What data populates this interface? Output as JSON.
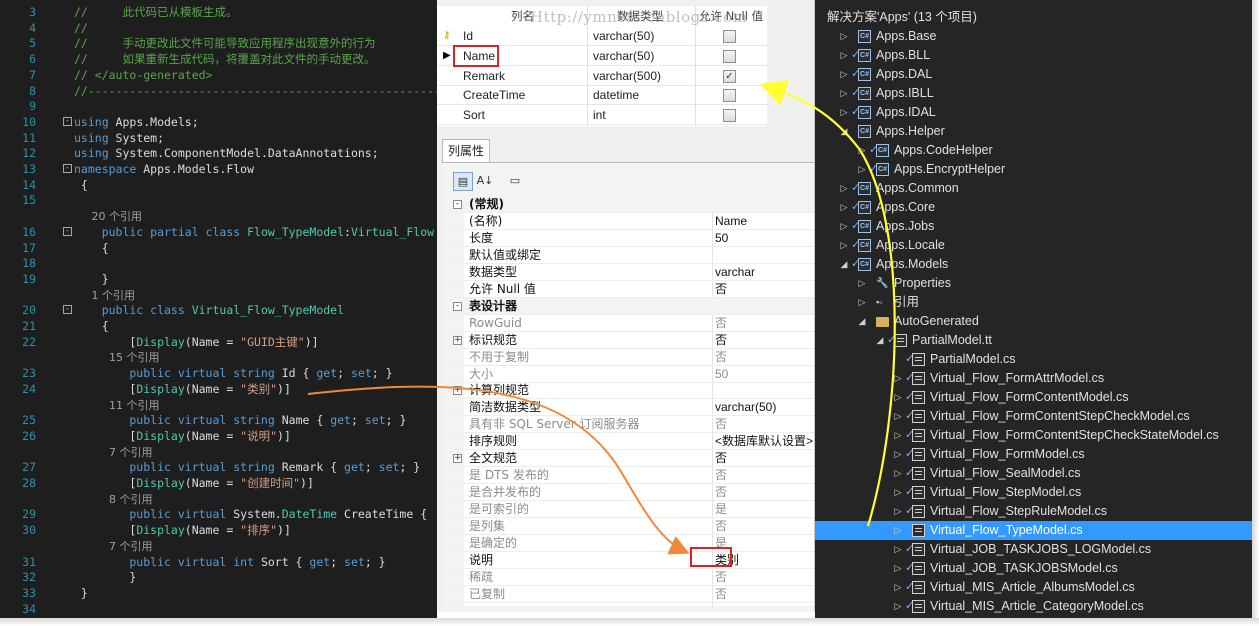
{
  "editor": {
    "lines": [
      {
        "num": "3",
        "fold": "",
        "parts": [
          {
            "t": "//     此代码已从模板生成。",
            "c": "c-com"
          }
        ]
      },
      {
        "num": "4",
        "fold": "",
        "parts": [
          {
            "t": "//",
            "c": "c-com"
          }
        ]
      },
      {
        "num": "5",
        "fold": "",
        "parts": [
          {
            "t": "//     手动更改此文件可能导致应用程序出现意外的行为",
            "c": "c-com"
          }
        ]
      },
      {
        "num": "6",
        "fold": "",
        "parts": [
          {
            "t": "//     如果重新生成代码，将覆盖对此文件的手动更改。",
            "c": "c-com"
          }
        ]
      },
      {
        "num": "7",
        "fold": "",
        "parts": [
          {
            "t": "// </auto-generated>",
            "c": "c-com"
          }
        ]
      },
      {
        "num": "8",
        "fold": "",
        "parts": [
          {
            "t": "//------------------------------------------------------------------",
            "c": "c-com"
          }
        ]
      },
      {
        "num": "9",
        "fold": "",
        "parts": []
      },
      {
        "num": "10",
        "fold": "-",
        "parts": [
          {
            "t": "using",
            "c": "c-kw"
          },
          {
            "t": " Apps.Models;",
            "c": "c-plain"
          }
        ]
      },
      {
        "num": "11",
        "fold": "",
        "parts": [
          {
            "t": "using",
            "c": "c-kw"
          },
          {
            "t": " System;",
            "c": "c-plain"
          }
        ]
      },
      {
        "num": "12",
        "fold": "",
        "parts": [
          {
            "t": "using",
            "c": "c-kw"
          },
          {
            "t": " System.ComponentModel.DataAnnotations;",
            "c": "c-plain"
          }
        ]
      },
      {
        "num": "13",
        "fold": "-",
        "parts": [
          {
            "t": "namespace",
            "c": "c-kw"
          },
          {
            "t": " Apps.Models.Flow",
            "c": "c-plain"
          }
        ]
      },
      {
        "num": "14",
        "fold": "",
        "parts": [
          {
            "t": " {",
            "c": "c-plain"
          }
        ]
      },
      {
        "num": "15",
        "fold": "",
        "parts": []
      },
      {
        "num": "",
        "fold": "",
        "ref": true,
        "parts": [
          {
            "t": "     20 个引用",
            "c": "ref"
          }
        ]
      },
      {
        "num": "16",
        "fold": "-",
        "parts": [
          {
            "t": "    public partial class ",
            "c": "c-kw"
          },
          {
            "t": "Flow_TypeModel",
            "c": "c-type"
          },
          {
            "t": ":",
            "c": "c-plain"
          },
          {
            "t": "Virtual_Flow",
            "c": "c-type"
          }
        ]
      },
      {
        "num": "17",
        "fold": "",
        "parts": [
          {
            "t": "    {",
            "c": "c-plain"
          }
        ]
      },
      {
        "num": "18",
        "fold": "",
        "parts": []
      },
      {
        "num": "19",
        "fold": "",
        "parts": [
          {
            "t": "    }",
            "c": "c-plain"
          }
        ]
      },
      {
        "num": "",
        "fold": "",
        "ref": true,
        "parts": [
          {
            "t": "     1 个引用",
            "c": "ref"
          }
        ]
      },
      {
        "num": "20",
        "fold": "-",
        "parts": [
          {
            "t": "    public class ",
            "c": "c-kw"
          },
          {
            "t": "Virtual_Flow_TypeModel",
            "c": "c-type"
          }
        ]
      },
      {
        "num": "21",
        "fold": "",
        "parts": [
          {
            "t": "    {",
            "c": "c-plain"
          }
        ]
      },
      {
        "num": "22",
        "fold": "",
        "parts": [
          {
            "t": "        [",
            "c": "c-plain"
          },
          {
            "t": "Display",
            "c": "c-type"
          },
          {
            "t": "(Name = ",
            "c": "c-plain"
          },
          {
            "t": "\"GUID主键\"",
            "c": "c-str"
          },
          {
            "t": ")]",
            "c": "c-plain"
          }
        ]
      },
      {
        "num": "",
        "fold": "",
        "ref": true,
        "parts": [
          {
            "t": "          15 个引用",
            "c": "ref"
          }
        ]
      },
      {
        "num": "23",
        "fold": "",
        "parts": [
          {
            "t": "        public virtual string ",
            "c": "c-kw"
          },
          {
            "t": "Id { ",
            "c": "c-plain"
          },
          {
            "t": "get",
            "c": "c-kw"
          },
          {
            "t": "; ",
            "c": "c-plain"
          },
          {
            "t": "set",
            "c": "c-kw"
          },
          {
            "t": "; }",
            "c": "c-plain"
          }
        ]
      },
      {
        "num": "24",
        "fold": "",
        "parts": [
          {
            "t": "        [",
            "c": "c-plain"
          },
          {
            "t": "Display",
            "c": "c-type"
          },
          {
            "t": "(Name = ",
            "c": "c-plain"
          },
          {
            "t": "\"类别\"",
            "c": "c-str"
          },
          {
            "t": ")]",
            "c": "c-plain"
          }
        ]
      },
      {
        "num": "",
        "fold": "",
        "ref": true,
        "parts": [
          {
            "t": "          11 个引用",
            "c": "ref"
          }
        ]
      },
      {
        "num": "25",
        "fold": "",
        "parts": [
          {
            "t": "        public virtual string ",
            "c": "c-kw"
          },
          {
            "t": "Name { ",
            "c": "c-plain"
          },
          {
            "t": "get",
            "c": "c-kw"
          },
          {
            "t": "; ",
            "c": "c-plain"
          },
          {
            "t": "set",
            "c": "c-kw"
          },
          {
            "t": "; }",
            "c": "c-plain"
          }
        ]
      },
      {
        "num": "26",
        "fold": "",
        "parts": [
          {
            "t": "        [",
            "c": "c-plain"
          },
          {
            "t": "Display",
            "c": "c-type"
          },
          {
            "t": "(Name = ",
            "c": "c-plain"
          },
          {
            "t": "\"说明\"",
            "c": "c-str"
          },
          {
            "t": ")]",
            "c": "c-plain"
          }
        ]
      },
      {
        "num": "",
        "fold": "",
        "ref": true,
        "parts": [
          {
            "t": "          7 个引用",
            "c": "ref"
          }
        ]
      },
      {
        "num": "27",
        "fold": "",
        "parts": [
          {
            "t": "        public virtual string ",
            "c": "c-kw"
          },
          {
            "t": "Remark { ",
            "c": "c-plain"
          },
          {
            "t": "get",
            "c": "c-kw"
          },
          {
            "t": "; ",
            "c": "c-plain"
          },
          {
            "t": "set",
            "c": "c-kw"
          },
          {
            "t": "; }",
            "c": "c-plain"
          }
        ]
      },
      {
        "num": "28",
        "fold": "",
        "parts": [
          {
            "t": "        [",
            "c": "c-plain"
          },
          {
            "t": "Display",
            "c": "c-type"
          },
          {
            "t": "(Name = ",
            "c": "c-plain"
          },
          {
            "t": "\"创建时间\"",
            "c": "c-str"
          },
          {
            "t": ")]",
            "c": "c-plain"
          }
        ]
      },
      {
        "num": "",
        "fold": "",
        "ref": true,
        "parts": [
          {
            "t": "          8 个引用",
            "c": "ref"
          }
        ]
      },
      {
        "num": "29",
        "fold": "",
        "parts": [
          {
            "t": "        public virtual ",
            "c": "c-kw"
          },
          {
            "t": "System.",
            "c": "c-plain"
          },
          {
            "t": "DateTime",
            "c": "c-type"
          },
          {
            "t": " CreateTime {",
            "c": "c-plain"
          }
        ]
      },
      {
        "num": "30",
        "fold": "",
        "parts": [
          {
            "t": "        [",
            "c": "c-plain"
          },
          {
            "t": "Display",
            "c": "c-type"
          },
          {
            "t": "(Name = ",
            "c": "c-plain"
          },
          {
            "t": "\"排序\"",
            "c": "c-str"
          },
          {
            "t": ")]",
            "c": "c-plain"
          }
        ]
      },
      {
        "num": "",
        "fold": "",
        "ref": true,
        "parts": [
          {
            "t": "          7 个引用",
            "c": "ref"
          }
        ]
      },
      {
        "num": "31",
        "fold": "",
        "parts": [
          {
            "t": "        public virtual int ",
            "c": "c-kw"
          },
          {
            "t": "Sort { ",
            "c": "c-plain"
          },
          {
            "t": "get",
            "c": "c-kw"
          },
          {
            "t": "; ",
            "c": "c-plain"
          },
          {
            "t": "set",
            "c": "c-kw"
          },
          {
            "t": "; }",
            "c": "c-plain"
          }
        ]
      },
      {
        "num": "32",
        "fold": "",
        "parts": [
          {
            "t": "        }",
            "c": "c-plain"
          }
        ]
      },
      {
        "num": "33",
        "fold": "",
        "parts": [
          {
            "t": " }",
            "c": "c-plain"
          }
        ]
      },
      {
        "num": "34",
        "fold": "",
        "parts": []
      }
    ]
  },
  "designer": {
    "watermark": "Http://ymnets.cnblogs.com",
    "headers": {
      "name": "列名",
      "type": "数据类型",
      "null": "允许 Null 值"
    },
    "rows": [
      {
        "marker": "key",
        "name": "Id",
        "type": "varchar(50)",
        "allow_null": false
      },
      {
        "marker": "arrow",
        "name": "Name",
        "type": "varchar(50)",
        "allow_null": false
      },
      {
        "marker": "",
        "name": "Remark",
        "type": "varchar(500)",
        "allow_null": true
      },
      {
        "marker": "",
        "name": "CreateTime",
        "type": "datetime",
        "allow_null": false
      },
      {
        "marker": "",
        "name": "Sort",
        "type": "int",
        "allow_null": false
      }
    ],
    "prop_tab": "列属性",
    "properties": [
      {
        "kind": "cat",
        "name": "(常规)",
        "value": "",
        "exp": "-"
      },
      {
        "kind": "item",
        "name": "(名称)",
        "value": "Name"
      },
      {
        "kind": "item",
        "name": "长度",
        "value": "50"
      },
      {
        "kind": "item",
        "name": "默认值或绑定",
        "value": ""
      },
      {
        "kind": "item",
        "name": "数据类型",
        "value": "varchar"
      },
      {
        "kind": "item",
        "name": "允许 Null 值",
        "value": "否"
      },
      {
        "kind": "cat",
        "name": "表设计器",
        "value": "",
        "exp": "-"
      },
      {
        "kind": "gray",
        "name": "RowGuid",
        "value": "否"
      },
      {
        "kind": "item",
        "name": "标识规范",
        "value": "否",
        "exp": "+"
      },
      {
        "kind": "gray",
        "name": "不用于复制",
        "value": "否"
      },
      {
        "kind": "gray",
        "name": "大小",
        "value": "50"
      },
      {
        "kind": "item",
        "name": "计算列规范",
        "value": "",
        "exp": "+"
      },
      {
        "kind": "item",
        "name": "简洁数据类型",
        "value": "varchar(50)"
      },
      {
        "kind": "gray",
        "name": "具有非 SQL Server 订阅服务器",
        "value": "否"
      },
      {
        "kind": "item",
        "name": "排序规则",
        "value": "<数据库默认设置>"
      },
      {
        "kind": "item",
        "name": "全文规范",
        "value": "否",
        "exp": "+"
      },
      {
        "kind": "gray",
        "name": "是 DTS 发布的",
        "value": "否"
      },
      {
        "kind": "gray",
        "name": "是合并发布的",
        "value": "否"
      },
      {
        "kind": "gray",
        "name": "是可索引的",
        "value": "是"
      },
      {
        "kind": "gray",
        "name": "是列集",
        "value": "否"
      },
      {
        "kind": "gray",
        "name": "是确定的",
        "value": "是"
      },
      {
        "kind": "item",
        "name": "说明",
        "value": "类别"
      },
      {
        "kind": "gray",
        "name": "稀疏",
        "value": "否"
      },
      {
        "kind": "gray",
        "name": "已复制",
        "value": "否"
      }
    ]
  },
  "solution": {
    "rows": [
      {
        "indent": 0,
        "arrow": "",
        "icon": "sln",
        "check": false,
        "label": "解决方案'Apps' (13 个项目)"
      },
      {
        "indent": 1,
        "arrow": "▷",
        "icon": "proj",
        "check": false,
        "label": "Apps.Base"
      },
      {
        "indent": 1,
        "arrow": "▷",
        "icon": "proj",
        "check": true,
        "label": "Apps.BLL"
      },
      {
        "indent": 1,
        "arrow": "▷",
        "icon": "proj",
        "check": true,
        "label": "Apps.DAL"
      },
      {
        "indent": 1,
        "arrow": "▷",
        "icon": "proj",
        "check": true,
        "label": "Apps.IBLL"
      },
      {
        "indent": 1,
        "arrow": "▷",
        "icon": "proj",
        "check": true,
        "label": "Apps.IDAL"
      },
      {
        "indent": 1,
        "arrow": "◢",
        "icon": "proj",
        "check": false,
        "label": "Apps.Helper"
      },
      {
        "indent": 2,
        "arrow": "▷",
        "icon": "proj",
        "check": true,
        "label": "Apps.CodeHelper"
      },
      {
        "indent": 2,
        "arrow": "▷",
        "icon": "proj",
        "check": true,
        "label": "Apps.EncryptHelper"
      },
      {
        "indent": 1,
        "arrow": "▷",
        "icon": "proj",
        "check": true,
        "label": "Apps.Common"
      },
      {
        "indent": 1,
        "arrow": "▷",
        "icon": "proj",
        "check": true,
        "label": "Apps.Core"
      },
      {
        "indent": 1,
        "arrow": "▷",
        "icon": "proj",
        "check": true,
        "label": "Apps.Jobs"
      },
      {
        "indent": 1,
        "arrow": "▷",
        "icon": "proj",
        "check": true,
        "label": "Apps.Locale"
      },
      {
        "indent": 1,
        "arrow": "◢",
        "icon": "proj",
        "check": true,
        "label": "Apps.Models"
      },
      {
        "indent": 2,
        "arrow": "▷",
        "icon": "wrench",
        "check": false,
        "label": "Properties"
      },
      {
        "indent": 2,
        "arrow": "▷",
        "icon": "ref",
        "check": false,
        "label": "引用"
      },
      {
        "indent": 2,
        "arrow": "◢",
        "icon": "folder",
        "check": false,
        "label": "AutoGenerated"
      },
      {
        "indent": 3,
        "arrow": "◢",
        "icon": "file",
        "check": true,
        "label": "PartialModel.tt"
      },
      {
        "indent": 4,
        "arrow": "",
        "icon": "file",
        "check": true,
        "label": "PartialModel.cs"
      },
      {
        "indent": 4,
        "arrow": "▷",
        "icon": "file",
        "check": true,
        "label": "Virtual_Flow_FormAttrModel.cs"
      },
      {
        "indent": 4,
        "arrow": "▷",
        "icon": "file",
        "check": true,
        "label": "Virtual_Flow_FormContentModel.cs"
      },
      {
        "indent": 4,
        "arrow": "▷",
        "icon": "file",
        "check": true,
        "label": "Virtual_Flow_FormContentStepCheckModel.cs"
      },
      {
        "indent": 4,
        "arrow": "▷",
        "icon": "file",
        "check": true,
        "label": "Virtual_Flow_FormContentStepCheckStateModel.cs"
      },
      {
        "indent": 4,
        "arrow": "▷",
        "icon": "file",
        "check": true,
        "label": "Virtual_Flow_FormModel.cs"
      },
      {
        "indent": 4,
        "arrow": "▷",
        "icon": "file",
        "check": true,
        "label": "Virtual_Flow_SealModel.cs"
      },
      {
        "indent": 4,
        "arrow": "▷",
        "icon": "file",
        "check": true,
        "label": "Virtual_Flow_StepModel.cs"
      },
      {
        "indent": 4,
        "arrow": "▷",
        "icon": "file",
        "check": true,
        "label": "Virtual_Flow_StepRuleModel.cs"
      },
      {
        "indent": 4,
        "arrow": "▷",
        "icon": "file",
        "check": false,
        "label": "Virtual_Flow_TypeModel.cs",
        "selected": true
      },
      {
        "indent": 4,
        "arrow": "▷",
        "icon": "file",
        "check": true,
        "label": "Virtual_JOB_TASKJOBS_LOGModel.cs"
      },
      {
        "indent": 4,
        "arrow": "▷",
        "icon": "file",
        "check": true,
        "label": "Virtual_JOB_TASKJOBSModel.cs"
      },
      {
        "indent": 4,
        "arrow": "▷",
        "icon": "file",
        "check": true,
        "label": "Virtual_MIS_Article_AlbumsModel.cs"
      },
      {
        "indent": 4,
        "arrow": "▷",
        "icon": "file",
        "check": true,
        "label": "Virtual_MIS_Article_CategoryModel.cs"
      }
    ]
  },
  "colors": {
    "orange_arrow": "#f0883a",
    "yellow_arrow": "#ffff33",
    "highlight": "#e02020",
    "selection": "#3399ff"
  }
}
